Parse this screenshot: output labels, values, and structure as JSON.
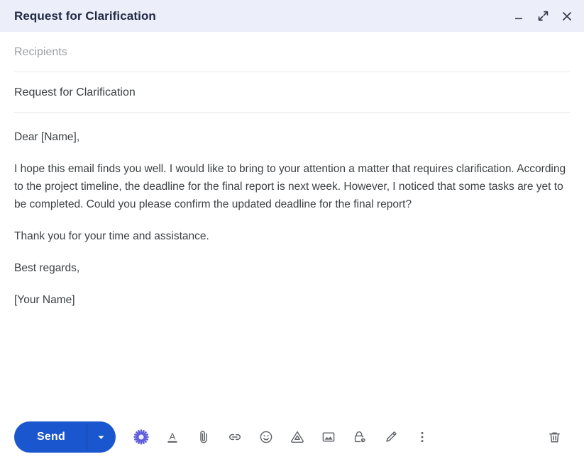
{
  "window": {
    "title": "Request for Clarification",
    "controls": [
      {
        "name": "minimize",
        "label": "Minimize"
      },
      {
        "name": "expand",
        "label": "Full screen"
      },
      {
        "name": "close",
        "label": "Save & close"
      }
    ]
  },
  "fields": {
    "recipients_placeholder": "Recipients",
    "recipients_value": "",
    "subject_value": "Request for Clarification"
  },
  "body": {
    "paragraphs": [
      "Dear [Name],",
      "I hope this email finds you well. I would like to bring to your attention a matter that requires clarification. According to the project timeline, the deadline for the final report is next week. However, I noticed that some tasks are yet to be completed. Could you please confirm the updated deadline for the final report?",
      "Thank you for your time and assistance.",
      "Best regards,",
      "[Your Name]"
    ]
  },
  "toolbar": {
    "send_label": "Send",
    "send_options_label": "More send options",
    "icons": [
      {
        "name": "gemini-icon",
        "label": "Help me write"
      },
      {
        "name": "formatting-icon",
        "label": "Formatting options"
      },
      {
        "name": "attach-icon",
        "label": "Attach files"
      },
      {
        "name": "link-icon",
        "label": "Insert link"
      },
      {
        "name": "emoji-icon",
        "label": "Insert emoji"
      },
      {
        "name": "drive-icon",
        "label": "Insert files using Drive"
      },
      {
        "name": "image-icon",
        "label": "Insert photo"
      },
      {
        "name": "confidential-icon",
        "label": "Toggle confidential mode"
      },
      {
        "name": "signature-icon",
        "label": "Insert signature"
      },
      {
        "name": "more-options-icon",
        "label": "More options"
      }
    ],
    "discard_label": "Discard draft"
  },
  "colors": {
    "header_bg": "#eceff9",
    "title_text": "#202a44",
    "send_blue": "#1a56cd",
    "gemini_purple": "#5f5ddb",
    "icon_gray": "#5f6368",
    "divider": "#e8eaed"
  }
}
